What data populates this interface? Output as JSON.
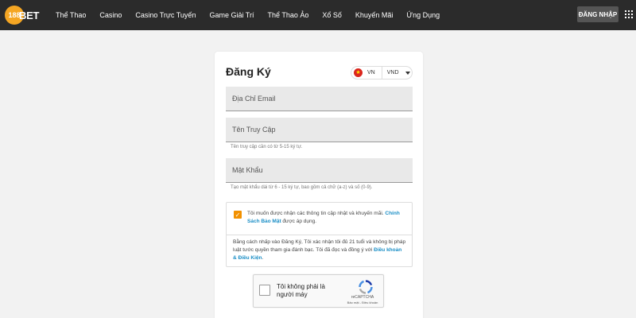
{
  "header": {
    "logo_text": "188BET",
    "logo_badge": "188",
    "logo_tail": "BET",
    "nav": [
      "Thể Thao",
      "Casino",
      "Casino Trực Tuyến",
      "Game Giải Trí",
      "Thể Thao Ảo",
      "Xổ Số",
      "Khuyến Mãi",
      "Ứng Dụng"
    ],
    "login_label": "ĐĂNG NHẬP",
    "menu_icon": "grid-icon"
  },
  "form": {
    "title": "Đăng Ký",
    "language": {
      "flag_icon": "vietnam-flag-icon",
      "code": "VN",
      "currency": "VND"
    },
    "email_placeholder": "Địa Chỉ Email",
    "username_placeholder": "Tên Truy Cập",
    "username_hint": "Tên truy cập cần có từ 5-15 ký tự.",
    "password_placeholder": "Mật Khẩu",
    "password_hint": "Tạo mật khẩu dài từ 6 - 15 ký tự, bao gồm cả chữ (a-z) và số (0-9).",
    "marketing": {
      "checked": true,
      "text_before": "Tôi muốn được nhận các thông tin cập nhật và khuyến mãi. ",
      "link": "Chính Sách Bảo Mật",
      "text_after": " được áp dụng."
    },
    "terms": {
      "text": "Bằng cách nhấp vào Đăng Ký, Tôi xác nhận tôi đủ 21 tuổi và không bị pháp luật tước quyền tham gia đánh bạc. Tôi đã đọc và đồng ý với ",
      "link": "Điều khoản & Điều Kiện",
      "end": "."
    },
    "recaptcha": {
      "label": "Tôi không phải là người máy",
      "brand": "reCAPTCHA",
      "links": "Bảo mật - Điều khoản",
      "accent_color": "#1c3aa9"
    }
  },
  "colors": {
    "topbar": "#2b2b2b",
    "accent": "#f29100",
    "link": "#1a8ec6"
  }
}
